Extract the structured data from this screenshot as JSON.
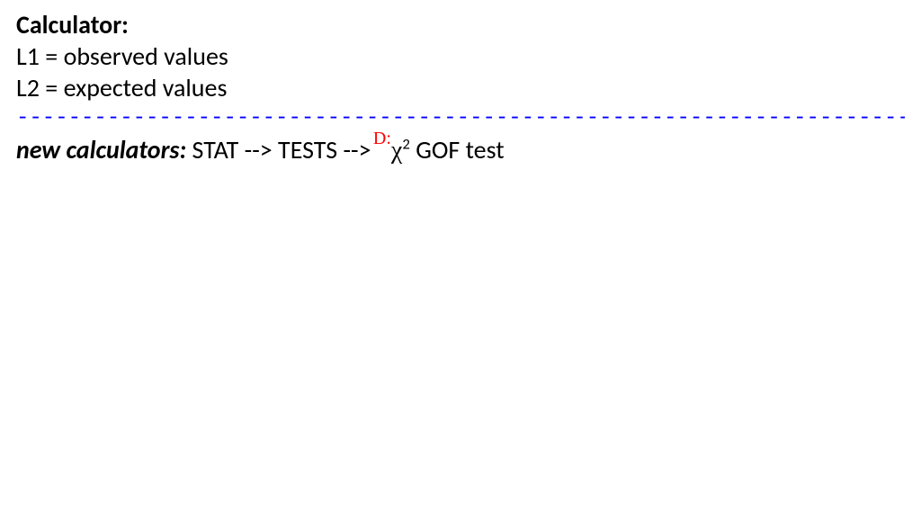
{
  "heading": "Calculator:",
  "line1": "L1 = observed values",
  "line2": "L2 = expected values",
  "divider": "-------------------------------------------------------------------------",
  "newcalc_label": "new calculators:",
  "newcalc_text1": " STAT --> TESTS --> ",
  "annotation": "D:",
  "chi": "χ",
  "sup": "2",
  "newcalc_text2": " GOF test"
}
